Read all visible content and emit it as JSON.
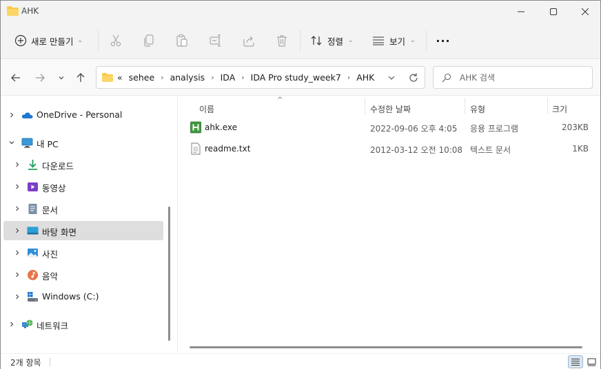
{
  "window": {
    "title": "AHK",
    "minimize_glyph": "—",
    "maximize_glyph": "☐",
    "close_glyph": "✕"
  },
  "commands": {
    "new_label": "새로 만들기",
    "sort_label": "정렬",
    "view_label": "보기",
    "more_label": "···",
    "icons": [
      "cut-icon",
      "copy-icon",
      "paste-icon",
      "rename-icon",
      "share-icon",
      "delete-icon"
    ]
  },
  "address": {
    "overflow": "«",
    "crumbs": [
      "sehee",
      "analysis",
      "IDA",
      "IDA Pro study_week7",
      "AHK"
    ],
    "separator": "›"
  },
  "search": {
    "placeholder": "AHK 검색"
  },
  "sidebar": {
    "items": [
      {
        "label": "OneDrive - Personal",
        "icon": "onedrive-icon"
      },
      {
        "label": "내 PC",
        "icon": "pc-icon"
      },
      {
        "label": "다운로드",
        "icon": "download-icon"
      },
      {
        "label": "동영상",
        "icon": "video-icon"
      },
      {
        "label": "문서",
        "icon": "document-icon"
      },
      {
        "label": "바탕 화면",
        "icon": "desktop-icon",
        "selected": true
      },
      {
        "label": "사진",
        "icon": "pictures-icon"
      },
      {
        "label": "음악",
        "icon": "music-icon"
      },
      {
        "label": "Windows (C:)",
        "icon": "drive-icon"
      },
      {
        "label": "네트워크",
        "icon": "network-icon"
      }
    ]
  },
  "columns": {
    "name": "이름",
    "date": "수정한 날짜",
    "type": "유형",
    "size": "크기"
  },
  "files": [
    {
      "name": "ahk.exe",
      "date": "2022-09-06 오후 4:05",
      "type": "응용 프로그램",
      "size": "203KB",
      "icon": "autohotkey-exe-icon"
    },
    {
      "name": "readme.txt",
      "date": "2012-03-12 오전 10:08",
      "type": "텍스트 문서",
      "size": "1KB",
      "icon": "text-file-icon"
    }
  ],
  "status": {
    "item_count": "2개 항목"
  },
  "colors": {
    "folder": "#f8c94a",
    "selection": "#dedede",
    "accent": "#2f7fd6"
  }
}
